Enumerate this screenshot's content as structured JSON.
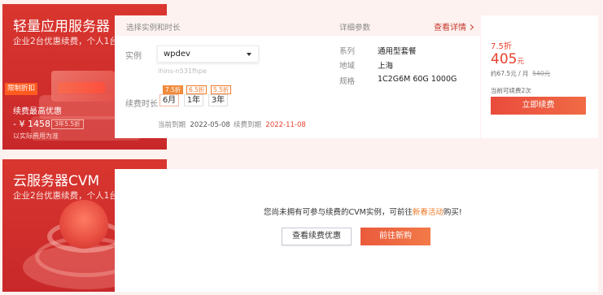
{
  "lighthouse": {
    "title": "轻量应用服务器",
    "subtitle": "企业2台优惠续费，个人1台",
    "promo_tag": "限制折扣",
    "renew_min_label": "续费最高优惠",
    "price_line": "- ¥ 1458",
    "price_tag": "3年5.5折",
    "note": "以实际费用为准"
  },
  "cvm": {
    "title": "云服务器CVM",
    "subtitle": "企业2台优惠续费，个人1台"
  },
  "instance_card": {
    "header_left": "选择实例和时长",
    "header_params": "详细参数",
    "view_details": "查看详情",
    "instance_label": "实例",
    "instance_value": "wpdev",
    "instance_id": "lhins-n531fhpe",
    "duration_label": "续费时长",
    "durations": [
      {
        "label": "6月",
        "discount": "7.5折",
        "selected": true
      },
      {
        "label": "1年",
        "discount": "6.5折",
        "selected": false
      },
      {
        "label": "3年",
        "discount": "5.5折",
        "selected": false
      }
    ],
    "expire_current_label": "当前到期",
    "expire_current": "2022-05-08",
    "expire_renew_label": "续费到期",
    "expire_renew": "2022-11-08",
    "specs": [
      {
        "key": "系列",
        "value": "通用型套餐"
      },
      {
        "key": "地域",
        "value": "上海"
      },
      {
        "key": "规格",
        "value": "1C2G6M 60G 1000G"
      }
    ]
  },
  "price_panel": {
    "discount": "7.5折",
    "price": "405",
    "unit": "元",
    "monthly": "约67.5元 / 月",
    "original": "540元",
    "renewable_info": "当前可续费2次",
    "renew_button": "立即续费"
  },
  "cvm_card": {
    "message_before": "您尚未拥有可参与续费的CVM实例，可前往",
    "message_link": "新春活动",
    "message_after": "购买!",
    "btn_view": "查看续费优惠",
    "btn_buy": "前往新购"
  },
  "colors": {
    "accent": "#e8412f",
    "brand_red": "#d9362f"
  }
}
